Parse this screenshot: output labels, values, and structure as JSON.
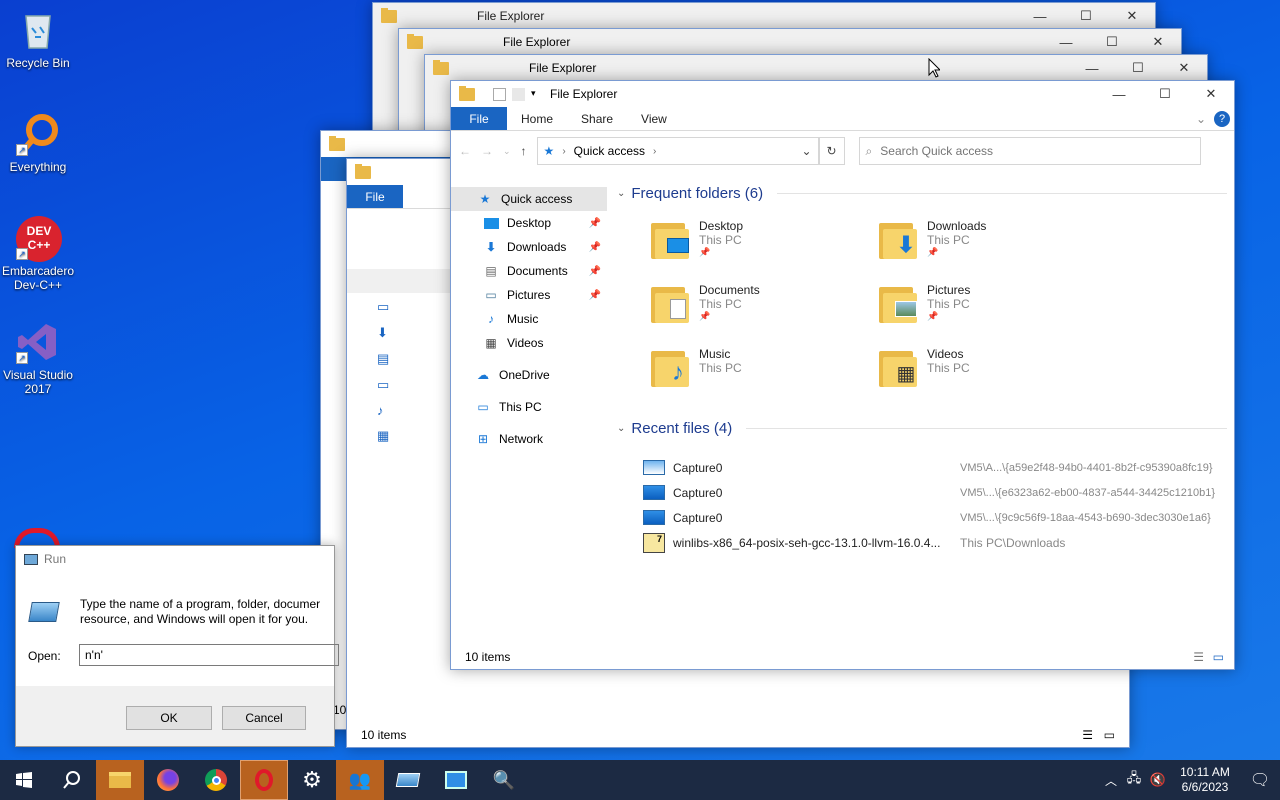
{
  "desktop": {
    "icons": [
      {
        "label": "Recycle Bin",
        "icon": "recycle-bin-icon"
      },
      {
        "label": "Everything",
        "icon": "everything-icon"
      },
      {
        "label": "Embarcadero Dev-C++",
        "icon": "devcpp-icon",
        "logo": "DEV C++"
      },
      {
        "label": "Visual Studio 2017",
        "icon": "visual-studio-icon"
      }
    ]
  },
  "explorer": {
    "title": "File Explorer",
    "tabs": {
      "file": "File",
      "home": "Home",
      "share": "Share",
      "view": "View"
    },
    "address": "Quick access",
    "search_placeholder": "Search Quick access",
    "nav": {
      "quick_access": "Quick access",
      "desktop": "Desktop",
      "downloads": "Downloads",
      "documents": "Documents",
      "pictures": "Pictures",
      "music": "Music",
      "videos": "Videos",
      "onedrive": "OneDrive",
      "this_pc": "This PC",
      "network": "Network"
    },
    "frequent_header": "Frequent folders (6)",
    "frequent": [
      {
        "name": "Desktop",
        "loc": "This PC",
        "pinned": true
      },
      {
        "name": "Downloads",
        "loc": "This PC",
        "pinned": true
      },
      {
        "name": "Documents",
        "loc": "This PC",
        "pinned": true
      },
      {
        "name": "Pictures",
        "loc": "This PC",
        "pinned": true
      },
      {
        "name": "Music",
        "loc": "This PC",
        "pinned": false
      },
      {
        "name": "Videos",
        "loc": "This PC",
        "pinned": false
      }
    ],
    "recent_header": "Recent files (4)",
    "recent": [
      {
        "name": "Capture0",
        "path": "VM5\\A...\\{a59e2f48-94b0-4401-8b2f-c95390a8fc19}"
      },
      {
        "name": "Capture0",
        "path": "VM5\\...\\{e6323a62-eb00-4837-a544-34425c1210b1}"
      },
      {
        "name": "Capture0",
        "path": "VM5\\...\\{9c9c56f9-18aa-4543-b690-3dec3030e1a6}"
      },
      {
        "name": "winlibs-x86_64-posix-seh-gcc-13.1.0-llvm-16.0.4...",
        "path": "This PC\\Downloads"
      }
    ],
    "status": "10 items",
    "back_status": "10 items",
    "partial_status": "10"
  },
  "run": {
    "title": "Run",
    "desc1": "Type the name of a program, folder, documer",
    "desc2": "resource, and Windows will open it for you.",
    "open_label": "Open:",
    "value": "n'n'",
    "ok": "OK",
    "cancel": "Cancel"
  },
  "taskbar": {
    "time": "10:11 AM",
    "date": "6/6/2023"
  },
  "colors": {
    "accent": "#1a65c2",
    "folder": "#e9b948",
    "taskbar": "#1c2a43"
  }
}
